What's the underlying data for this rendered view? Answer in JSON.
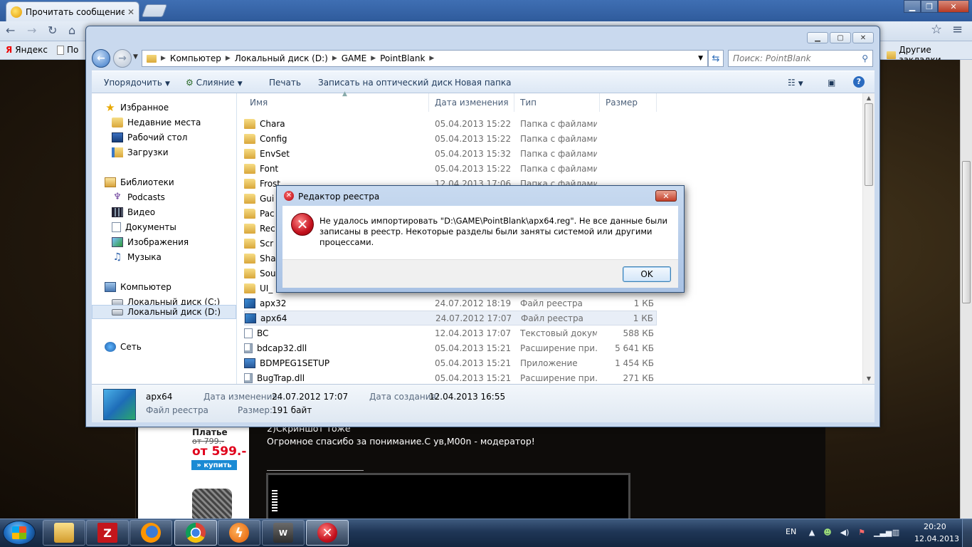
{
  "browser": {
    "tab_title": "Прочитать сообщение",
    "tab_close": "✕",
    "back_icon": "back-arrow-icon",
    "bookmarks": {
      "yandex": "Яндекс",
      "truncated": "По",
      "other": "Другие закладки"
    }
  },
  "webpage": {
    "ad": {
      "title": "Платье",
      "old_price": "от 799.-",
      "new_price": "от 599.-",
      "buy": "» купить"
    },
    "post_lines": [
      "2)Скриншот тоже",
      "Огромное спасибо за понимание.С ув,M00n - модератор!"
    ]
  },
  "explorer": {
    "breadcrumb": [
      "Компьютер",
      "Локальный диск (D:)",
      "GAME",
      "PointBlank"
    ],
    "search_placeholder": "Поиск: PointBlank",
    "toolbar": {
      "organize": "Упорядочить",
      "merge": "Слияние",
      "print": "Печать",
      "burn": "Записать на оптический диск",
      "new_folder": "Новая папка"
    },
    "nav": {
      "favorites": "Избранное",
      "recent": "Недавние места",
      "desktop": "Рабочий стол",
      "downloads": "Загрузки",
      "libraries": "Библиотеки",
      "podcasts": "Podcasts",
      "video": "Видео",
      "documents": "Документы",
      "images": "Изображения",
      "music": "Музыка",
      "computer": "Компьютер",
      "drive_c": "Локальный диск (C:)",
      "drive_d": "Локальный диск (D:)",
      "network": "Сеть"
    },
    "columns": {
      "name": "Имя",
      "date": "Дата изменения",
      "type": "Тип",
      "size": "Размер"
    },
    "files": [
      {
        "name": "Chara",
        "date": "05.04.2013 15:22",
        "type": "Папка с файлами",
        "size": "",
        "icon": "folder"
      },
      {
        "name": "Config",
        "date": "05.04.2013 15:22",
        "type": "Папка с файлами",
        "size": "",
        "icon": "folder"
      },
      {
        "name": "EnvSet",
        "date": "05.04.2013 15:32",
        "type": "Папка с файлами",
        "size": "",
        "icon": "folder"
      },
      {
        "name": "Font",
        "date": "05.04.2013 15:22",
        "type": "Папка с файлами",
        "size": "",
        "icon": "folder"
      },
      {
        "name": "Frost",
        "date": "12.04.2013 17:06",
        "type": "Папка с файлами",
        "size": "",
        "icon": "folder"
      },
      {
        "name": "Gui",
        "date": "",
        "type": "",
        "size": "",
        "icon": "folder"
      },
      {
        "name": "Pac",
        "date": "",
        "type": "",
        "size": "",
        "icon": "folder"
      },
      {
        "name": "Rec",
        "date": "",
        "type": "",
        "size": "",
        "icon": "folder"
      },
      {
        "name": "Scr",
        "date": "",
        "type": "",
        "size": "",
        "icon": "folder"
      },
      {
        "name": "Sha",
        "date": "",
        "type": "",
        "size": "",
        "icon": "folder"
      },
      {
        "name": "Sou",
        "date": "",
        "type": "",
        "size": "",
        "icon": "folder"
      },
      {
        "name": "UI_",
        "date": "",
        "type": "",
        "size": "",
        "icon": "folder"
      },
      {
        "name": "apx32",
        "date": "24.07.2012 18:19",
        "type": "Файл реестра",
        "size": "1 КБ",
        "icon": "reg"
      },
      {
        "name": "apx64",
        "date": "24.07.2012 17:07",
        "type": "Файл реестра",
        "size": "1 КБ",
        "icon": "reg"
      },
      {
        "name": "BC",
        "date": "12.04.2013 17:07",
        "type": "Текстовый докум...",
        "size": "588 КБ",
        "icon": "txt"
      },
      {
        "name": "bdcap32.dll",
        "date": "05.04.2013 15:21",
        "type": "Расширение при...",
        "size": "5 641 КБ",
        "icon": "dll"
      },
      {
        "name": "BDMPEG1SETUP",
        "date": "05.04.2013 15:21",
        "type": "Приложение",
        "size": "1 454 КБ",
        "icon": "exe"
      },
      {
        "name": "BugTrap.dll",
        "date": "05.04.2013 15:21",
        "type": "Расширение при...",
        "size": "271 КБ",
        "icon": "dll"
      }
    ],
    "details": {
      "name": "apx64",
      "type": "Файл реестра",
      "modified_label": "Дата изменения:",
      "modified": "24.07.2012 17:07",
      "created_label": "Дата создания:",
      "created": "12.04.2013 16:55",
      "size_label": "Размер:",
      "size": "191 байт"
    }
  },
  "dialog": {
    "title": "Редактор реестра",
    "message": "Не удалось импортировать \"D:\\GAME\\PointBlank\\apx64.reg\". Не все данные были записаны в реестр. Некоторые разделы были заняты системой или другими процессами.",
    "ok": "OK",
    "close": "✕"
  },
  "taskbar": {
    "lang": "EN",
    "time": "20:20",
    "date": "12.04.2013"
  }
}
